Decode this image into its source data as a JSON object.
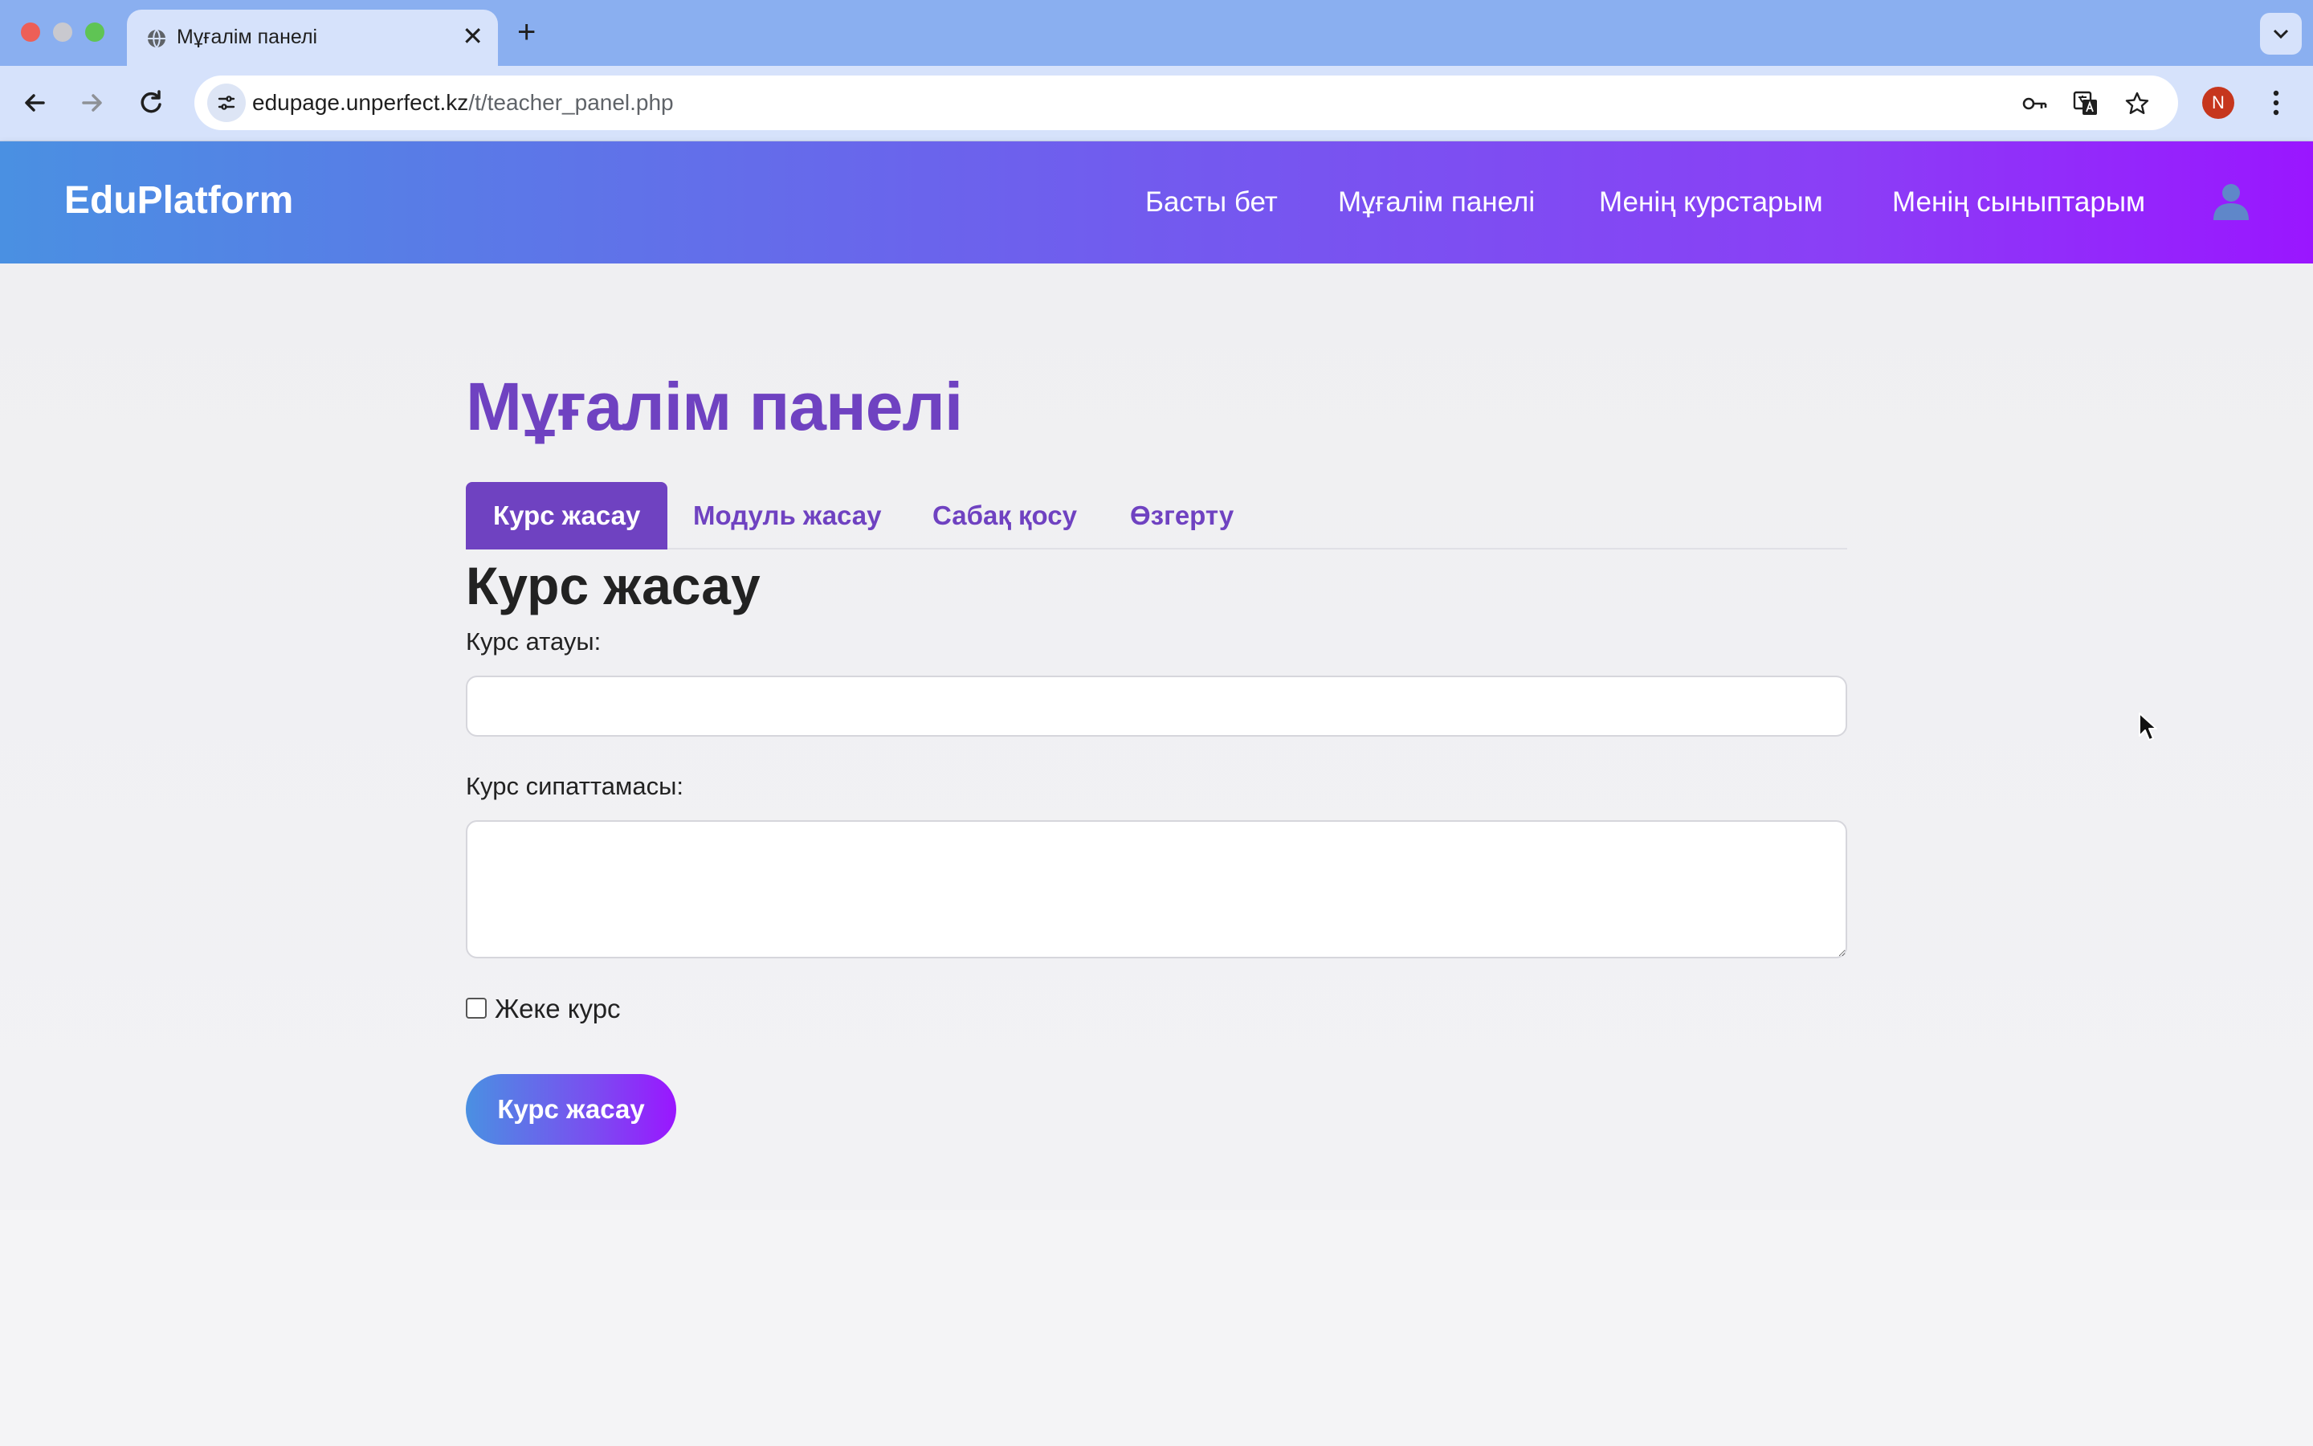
{
  "browser": {
    "tab_title": "Мұғалім панелі",
    "new_tab_label": "+",
    "close_label": "✕",
    "url_host": "edupage.unperfect.kz",
    "url_path": "/t/teacher_panel.php",
    "profile_initial": "N"
  },
  "header": {
    "logo": "EduPlatform",
    "nav": [
      {
        "label": "Басты бет"
      },
      {
        "label": "Мұғалім панелі"
      },
      {
        "label": "Менің курстарым"
      },
      {
        "label": "Менің сыныптарым"
      }
    ]
  },
  "main": {
    "page_title": "Мұғалім панелі",
    "tabs": [
      {
        "label": "Курс жасау",
        "active": true
      },
      {
        "label": "Модуль жасау",
        "active": false
      },
      {
        "label": "Сабақ қосу",
        "active": false
      },
      {
        "label": "Өзгерту",
        "active": false
      }
    ],
    "section_title": "Курс жасау",
    "form": {
      "course_name_label": "Курс атауы:",
      "course_name_value": "",
      "course_desc_label": "Курс сипаттамасы:",
      "course_desc_value": "",
      "private_label": "Жеке курс",
      "private_checked": false,
      "submit_label": "Курс жасау"
    }
  },
  "colors": {
    "accent": "#6f42c1",
    "header_gradient_start": "#4a90e2",
    "header_gradient_end": "#9a16ff"
  }
}
